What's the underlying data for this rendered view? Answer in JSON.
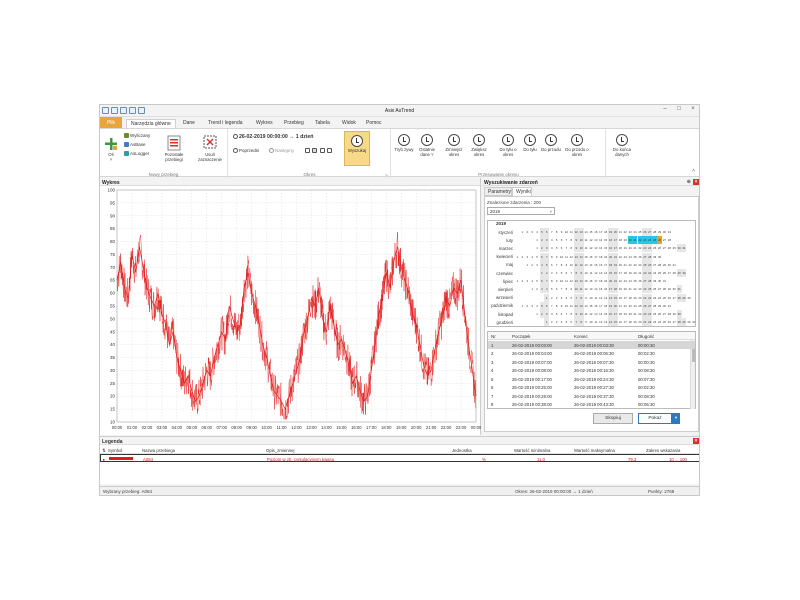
{
  "app": {
    "title": "Asix AsTrend"
  },
  "tabs": {
    "file": "Plik",
    "items": [
      "Narzędzia główne",
      "Dane",
      "Trend i legenda",
      "Wykres",
      "Przebieg",
      "Tabela",
      "Widok",
      "Pomoc"
    ]
  },
  "ribbon": {
    "axis_label": "Oś",
    "sources": [
      "Wyliczany",
      "AsBase",
      "AsLogger"
    ],
    "other_series": "Pozostałe przebiegi",
    "remove_selection": "Usuń zaznaczenie",
    "group_new_series": "Nowy przebieg",
    "period_text": "26-02-2019  00:00:00  →  1 dzień",
    "prev": "Poprzedni",
    "next": "Następny",
    "group_period": "Okres",
    "search": "Wyszukaj",
    "buttons": [
      {
        "label": "Tryb żywy"
      },
      {
        "label": "Ostatnie dane ˅"
      },
      {
        "label": "Zmniejsz okres"
      },
      {
        "label": "Zwiększ okres"
      },
      {
        "label": "Do tyłu o okres"
      },
      {
        "label": "Do tyłu"
      },
      {
        "label": "Do przodu"
      },
      {
        "label": "Do przodu o okres"
      },
      {
        "label": "Do końca danych"
      }
    ],
    "group_shift": "Przesuwanie okresu"
  },
  "chart": {
    "panel_title": "Wykres"
  },
  "chart_data": {
    "type": "line",
    "title": "",
    "xlabel": "",
    "ylabel": "",
    "ylim": [
      10,
      100
    ],
    "yticks": [
      10,
      15,
      20,
      25,
      30,
      35,
      40,
      45,
      50,
      55,
      60,
      65,
      70,
      75,
      80,
      85,
      90,
      95,
      100
    ],
    "xticks": [
      "00:00",
      "01:00",
      "02:00",
      "03:00",
      "04:00",
      "05:00",
      "06:00",
      "07:00",
      "08:00",
      "09:00",
      "10:00",
      "11:00",
      "12:00",
      "13:00",
      "14:00",
      "15:00",
      "16:00",
      "17:00",
      "18:00",
      "19:00",
      "20:00",
      "21:00",
      "22:00",
      "23:00",
      "00:00"
    ],
    "series": [
      {
        "color": "#e01b1b",
        "x": [
          0,
          0.25,
          0.5,
          0.75,
          1,
          1.25,
          1.5,
          1.75,
          2,
          2.25,
          2.5,
          2.75,
          3,
          3.25,
          3.5,
          3.75,
          4,
          4.25,
          4.5,
          4.75,
          5,
          5.25,
          5.5,
          5.75,
          6,
          6.25,
          6.5,
          6.75,
          7,
          7.25,
          7.5,
          7.75,
          8,
          8.25,
          8.5,
          8.75,
          9,
          9.25,
          9.5,
          9.75,
          10,
          10.25,
          10.5,
          10.75,
          11,
          11.25,
          11.5,
          11.75,
          12,
          12.25,
          12.5,
          12.75,
          13,
          13.25,
          13.5,
          13.75,
          14,
          14.25,
          14.5,
          14.75,
          15,
          15.25,
          15.5,
          15.75,
          16,
          16.25,
          16.5,
          16.75,
          17,
          17.25,
          17.5,
          17.75,
          18,
          18.25,
          18.5,
          18.75,
          19,
          19.25,
          19.5,
          19.75,
          20,
          20.25,
          20.5,
          20.75,
          21,
          21.25,
          21.5,
          21.75,
          22,
          22.25,
          22.5,
          22.75,
          23,
          23.25,
          23.5,
          23.75,
          24
        ],
        "values": [
          65,
          72,
          62,
          58,
          75,
          68,
          78,
          70,
          62,
          58,
          55,
          60,
          52,
          48,
          40,
          45,
          35,
          30,
          25,
          28,
          22,
          18,
          20,
          25,
          30,
          28,
          35,
          40,
          45,
          42,
          55,
          50,
          45,
          48,
          62,
          68,
          60,
          55,
          48,
          40,
          35,
          28,
          22,
          20,
          18,
          15,
          20,
          25,
          30,
          35,
          45,
          50,
          58,
          55,
          62,
          50,
          45,
          55,
          48,
          40,
          42,
          38,
          32,
          25,
          28,
          22,
          18,
          20,
          30,
          40,
          52,
          58,
          68,
          62,
          72,
          78,
          70,
          65,
          60,
          52,
          48,
          40,
          32,
          28,
          30,
          38,
          45,
          50,
          58,
          55,
          62,
          60,
          65,
          52,
          40,
          30,
          20
        ]
      }
    ]
  },
  "search_panel": {
    "title": "Wyszukiwanie zdarzeń",
    "tab_params": "Parametry",
    "tab_results": "Wyniki",
    "found": "Znalezione zdarzenia : 200",
    "year": "2019",
    "calendar_year": "2019",
    "months": [
      "styczeń",
      "luty",
      "marzec",
      "kwiecień",
      "maj",
      "czerwiec",
      "lipiec",
      "sierpień",
      "wrzesień",
      "październik",
      "listopad",
      "grudzień"
    ],
    "columns": [
      "Nr",
      "Początek",
      "Koniec",
      "Długość"
    ],
    "rows": [
      [
        "1",
        "26-02-2019 00:03:00",
        "26-02-2019 00:03:30",
        "00:00:30"
      ],
      [
        "2",
        "26-02-2019 00:04:00",
        "26-02-2019 00:06:30",
        "00:02:30"
      ],
      [
        "3",
        "26-02-2019 00:07:00",
        "26-02-2019 00:07:30",
        "00:00:30"
      ],
      [
        "4",
        "26-02-2019 00:08:00",
        "26-02-2019 00:16:30",
        "00:08:30"
      ],
      [
        "5",
        "26-02-2019 00:17:00",
        "26-02-2019 00:24:30",
        "00:07:30"
      ],
      [
        "6",
        "26-02-2019 00:25:00",
        "26-02-2019 00:27:30",
        "00:02:30"
      ],
      [
        "7",
        "26-02-2019 00:29:00",
        "26-02-2019 00:37:30",
        "00:08:30"
      ],
      [
        "8",
        "26-02-2019 00:38:00",
        "26-02-2019 00:43:30",
        "00:05:30"
      ]
    ],
    "copy": "Skopiuj",
    "show": "Pokaż"
  },
  "legend": {
    "title": "Legenda",
    "columns": [
      "Symbol",
      "Nazwa przebiegu",
      "Opis_zmiennej",
      "Jednostka",
      "Wartość minimalna",
      "Wartość maksymalna",
      "Zakres wskazania"
    ],
    "row": [
      "A084",
      "Poziom w zb. cyrkulacyjnym kwasu",
      "%",
      "11,0",
      "79,3",
      "10 ... 100"
    ]
  },
  "status": {
    "left": "Wybrany przebieg: A084",
    "middle": "Okres: 26-02-2019 00:00:00 → 1 dzień",
    "right": "Punkty: 2768"
  }
}
